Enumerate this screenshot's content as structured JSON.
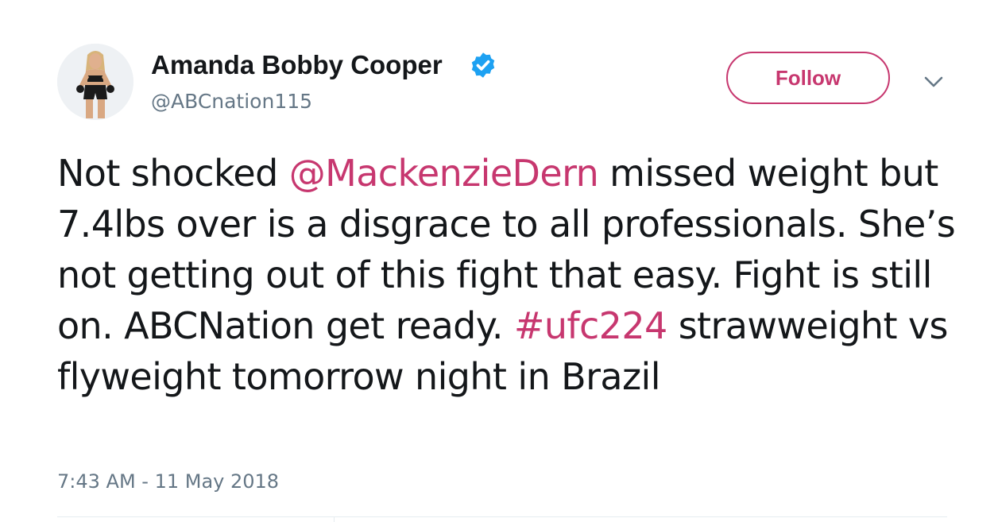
{
  "user": {
    "display_name": "Amanda Bobby Cooper",
    "handle": "@ABCnation115",
    "verified": true
  },
  "actions": {
    "follow_label": "Follow"
  },
  "tweet": {
    "segments": {
      "s1": "Not shocked ",
      "mention": "@MackenzieDern",
      "s2": " missed weight but 7.4lbs over is a disgrace to all professionals. She’s not getting out of this fight that easy. Fight is still on. ABCNation get ready. ",
      "hashtag": "#ufc224",
      "s3": " strawweight vs flyweight tomorrow night in Brazil"
    },
    "timestamp": "7:43 AM - 11 May 2018"
  },
  "colors": {
    "accent": "#c7376f",
    "verified": "#1da1f2",
    "text": "#14171a",
    "secondary": "#657786"
  },
  "icons": {
    "verified": "verified-badge-icon",
    "caret": "chevron-down-icon"
  }
}
